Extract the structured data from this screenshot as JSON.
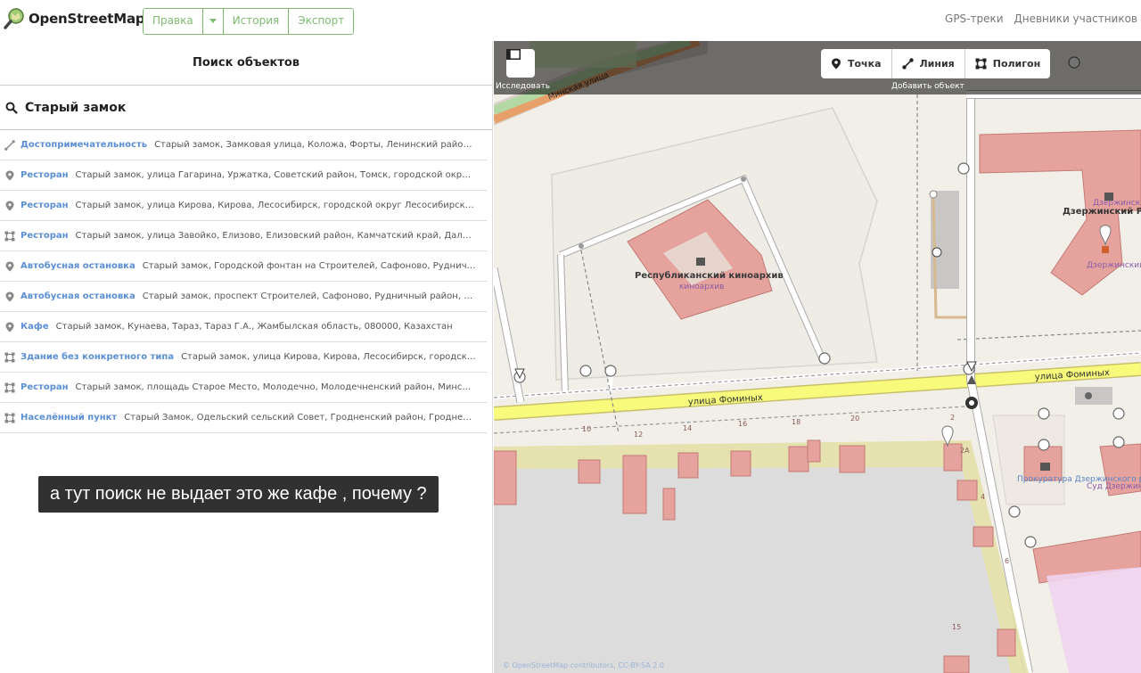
{
  "header": {
    "brand": "OpenStreetMap",
    "nav": {
      "edit": "Правка",
      "history": "История",
      "export": "Экспорт"
    },
    "links": {
      "gps": "GPS-треки",
      "diaries": "Дневники участников"
    }
  },
  "sidebar": {
    "title": "Поиск объектов",
    "query": "Старый замок",
    "results": [
      {
        "icon": "pencil-icon",
        "type": "Достопримечательность",
        "desc": "Старый замок, Замковая улица, Коложа, Форты, Ленинский район, Гродно, Гродненская область"
      },
      {
        "icon": "pin-icon",
        "type": "Ресторан",
        "desc": "Старый замок, улица Гагарина, Уржатка, Советский район, Томск, городской округ Томск, Томская область"
      },
      {
        "icon": "pin-icon",
        "type": "Ресторан",
        "desc": "Старый замок, улица Кирова, Кирова, Лесосибирск, городской округ Лесосибирск, Красноярский край"
      },
      {
        "icon": "polygon-icon",
        "type": "Ресторан",
        "desc": "Старый замок, улица Завойко, Елизово, Елизовский район, Камчатский край, Дальневосточный федеральный округ"
      },
      {
        "icon": "pin-icon",
        "type": "Автобусная остановка",
        "desc": "Старый замок, Городской фонтан на Строителей, Сафоново, Рудничный район, Прокопьевск"
      },
      {
        "icon": "pin-icon",
        "type": "Автобусная остановка",
        "desc": "Старый замок, проспект Строителей, Сафоново, Рудничный район, Прокопьевск, Кемеровская область"
      },
      {
        "icon": "pin-icon",
        "type": "Кафе",
        "desc": "Старый замок, Кунаева, Тараз, Тараз Г.А., Жамбылская область, 080000, Казахстан"
      },
      {
        "icon": "polygon-icon",
        "type": "Здание без конкретного типа",
        "desc": "Старый замок, улица Кирова, Кирова, Лесосибирск, городской округ Лесосибирск"
      },
      {
        "icon": "polygon-icon",
        "type": "Ресторан",
        "desc": "Старый замок, площадь Старое Место, Молодечно, Молодечненский район, Минская область, Беларусь"
      },
      {
        "icon": "polygon-icon",
        "type": "Населённый пункт",
        "desc": "Старый Замок, Одельский сельский Совет, Гродненский район, Гродненская область, Беларусь"
      }
    ]
  },
  "map": {
    "explore_label": "Исследовать",
    "add_label": "Добавить объект",
    "add_buttons": {
      "point": "Точка",
      "line": "Линия",
      "polygon": "Полигон"
    },
    "labels": {
      "street_1": "улица Фоминых",
      "street_2": "улица Фоминых",
      "street_top": "Минская улица",
      "archive_name": "Республиканский киноархив",
      "archive_sub": "киноархив",
      "rovd_1": "Дзержинский РОВД",
      "rovd_1_sub": "Дзержинский РОВД",
      "rovd_2": "Дзержинский РОВД",
      "prosecutor": "Прокуратура Дзержинского района",
      "court": "Суд Дзержинского района",
      "house_numbers": [
        "10",
        "12",
        "14",
        "16",
        "18",
        "20",
        "2",
        "2А",
        "4",
        "6",
        "15"
      ]
    },
    "attribution": "© OpenStreetMap contributors, CC-BY-SA 2.0",
    "colors": {
      "road": "#f7fa7b",
      "building": "#e6a39e",
      "landuse": "#d9d0c9"
    }
  },
  "caption": "а тут поиск не выдает это же кафе , почему ?"
}
